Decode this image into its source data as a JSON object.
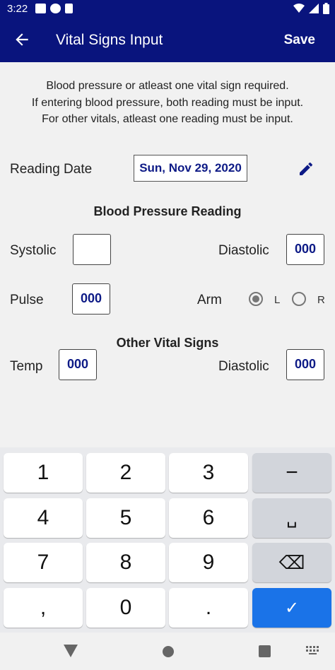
{
  "status_bar": {
    "time": "3:22",
    "icons": [
      "gmail-icon",
      "contact-icon",
      "sd-card-icon",
      "wifi-icon",
      "signal-icon",
      "battery-icon"
    ]
  },
  "app_bar": {
    "title": "Vital Signs Input",
    "save_label": "Save",
    "color": "#09147d"
  },
  "instructions": [
    "Blood pressure or atleast one vital sign required.",
    "If entering blood pressure, both reading must be input.",
    "For other vitals, atleast one reading must be input."
  ],
  "reading_date": {
    "label": "Reading Date",
    "value": "Sun, Nov 29, 2020"
  },
  "blood_pressure": {
    "heading": "Blood Pressure Reading",
    "systolic_label": "Systolic",
    "systolic_value": "",
    "diastolic_label": "Diastolic",
    "diastolic_value": "000",
    "pulse_label": "Pulse",
    "pulse_value": "000",
    "arm_label": "Arm",
    "arm_options": [
      "L",
      "R"
    ],
    "arm_selected": "L"
  },
  "other_vitals": {
    "heading": "Other Vital Signs",
    "temp_label": "Temp",
    "temp_value": "000",
    "diastolic_label": "Diastolic",
    "diastolic_value": "000"
  },
  "keyboard": {
    "keys": [
      "1",
      "2",
      "3",
      "−",
      "4",
      "5",
      "6",
      "␣",
      "7",
      "8",
      "9",
      "⌫",
      ",",
      "0",
      ".",
      "✓"
    ],
    "accent": "#1a73e8"
  }
}
